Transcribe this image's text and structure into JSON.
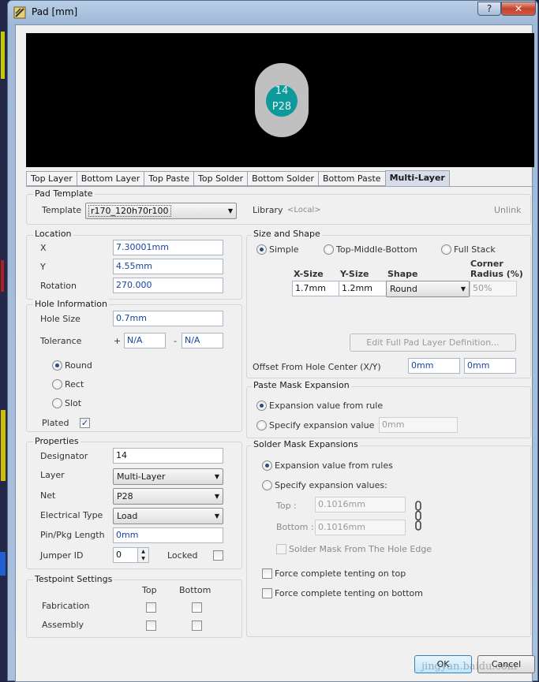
{
  "window": {
    "title": "Pad [mm]",
    "help_glyph": "?",
    "close_glyph": "✕"
  },
  "preview": {
    "designator": "14",
    "net": "P28"
  },
  "tabs": [
    "Top Layer",
    "Bottom Layer",
    "Top Paste",
    "Top Solder",
    "Bottom Solder",
    "Bottom Paste",
    "Multi-Layer"
  ],
  "pad_template": {
    "title": "Pad Template",
    "template_label": "Template",
    "template_value": "r170_120h70r100",
    "library_label": "Library",
    "library_value": "<Local>",
    "unlink_label": "Unlink"
  },
  "location": {
    "title": "Location",
    "x_label": "X",
    "x_value": "7.30001mm",
    "y_label": "Y",
    "y_value": "4.55mm",
    "rotation_label": "Rotation",
    "rotation_value": "270.000"
  },
  "hole": {
    "title": "Hole Information",
    "size_label": "Hole Size",
    "size_value": "0.7mm",
    "tolerance_label": "Tolerance",
    "plus": "+",
    "minus": "-",
    "tol_plus_value": "N/A",
    "tol_minus_value": "N/A",
    "round_label": "Round",
    "rect_label": "Rect",
    "slot_label": "Slot",
    "plated_label": "Plated",
    "selected_shape": "Round"
  },
  "properties": {
    "title": "Properties",
    "designator_label": "Designator",
    "designator_value": "14",
    "layer_label": "Layer",
    "layer_value": "Multi-Layer",
    "net_label": "Net",
    "net_value": "P28",
    "etype_label": "Electrical Type",
    "etype_value": "Load",
    "pinlen_label": "Pin/Pkg Length",
    "pinlen_value": "0mm",
    "jumper_label": "Jumper ID",
    "jumper_value": "0",
    "locked_label": "Locked"
  },
  "testpoint": {
    "title": "Testpoint Settings",
    "top_label": "Top",
    "bottom_label": "Bottom",
    "fabrication_label": "Fabrication",
    "assembly_label": "Assembly"
  },
  "size_shape": {
    "title": "Size and Shape",
    "simple_label": "Simple",
    "tmb_label": "Top-Middle-Bottom",
    "full_label": "Full Stack",
    "xsize_label": "X-Size",
    "ysize_label": "Y-Size",
    "shape_label": "Shape",
    "corner_label_1": "Corner",
    "corner_label_2": "Radius (%)",
    "xsize_value": "1.7mm",
    "ysize_value": "1.2mm",
    "shape_value": "Round",
    "corner_value": "50%",
    "edit_full_label": "Edit Full Pad Layer Definition...",
    "offset_label": "Offset From Hole Center (X/Y)",
    "offset_x": "0mm",
    "offset_y": "0mm"
  },
  "paste_mask": {
    "title": "Paste Mask Expansion",
    "rule_label": "Expansion value from rule",
    "specify_label": "Specify expansion value",
    "specify_value": "0mm"
  },
  "solder_mask": {
    "title": "Solder Mask Expansions",
    "rules_label": "Expansion value from rules",
    "specify_label": "Specify expansion values:",
    "top_label": "Top :",
    "top_value": "0.1016mm",
    "bottom_label": "Bottom :",
    "bottom_value": "0.1016mm",
    "hole_edge_label": "Solder Mask From The Hole Edge",
    "tent_top_label": "Force complete tenting on top",
    "tent_bottom_label": "Force complete tenting on bottom"
  },
  "buttons": {
    "ok": "OK",
    "cancel": "Cancel"
  },
  "watermark": "jingyan.baidu.com"
}
